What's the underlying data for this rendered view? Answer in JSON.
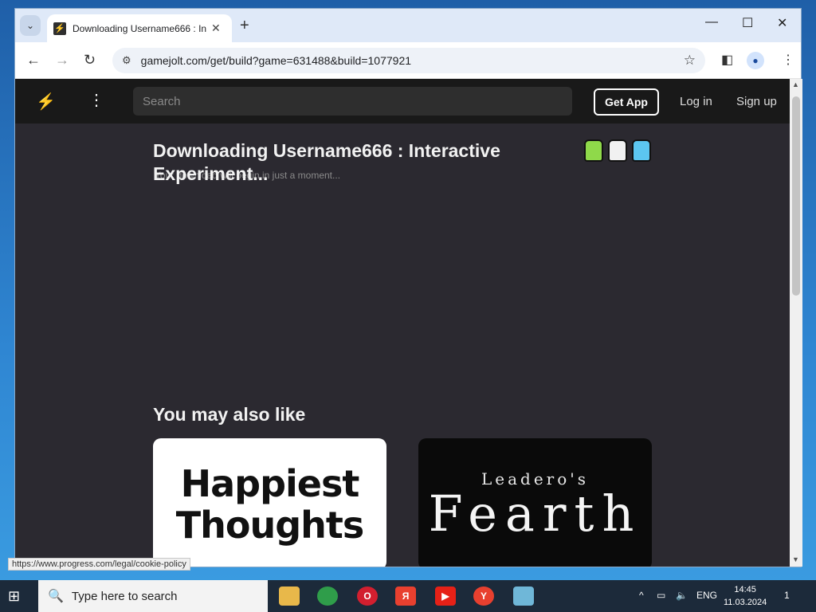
{
  "browser": {
    "tab_title": "Downloading Username666 : In",
    "url": "gamejolt.com/get/build?game=631488&build=1077921",
    "status_url": "https://www.progress.com/legal/cookie-policy"
  },
  "gj_nav": {
    "search_placeholder": "Search",
    "get_app": "Get App",
    "login": "Log in",
    "signup": "Sign up"
  },
  "main": {
    "title": "Downloading Username666 : Interactive Experiment...",
    "subtitle": "Your download will begin in just a moment...",
    "ymal_heading": "You may also like",
    "cards": [
      {
        "line1": "Happiest",
        "line2": "Thoughts"
      },
      {
        "small": "Leadero's",
        "big": "Fearth"
      }
    ],
    "mascot_colors": [
      "#8fd94a",
      "#f1f1f1",
      "#5cc6f0"
    ]
  },
  "taskbar": {
    "search_placeholder": "Type here to search",
    "lang": "ENG",
    "time": "14:45",
    "date": "11.03.2024",
    "notification_count": "1"
  },
  "icons": [
    "tab-search-icon",
    "close-icon",
    "new-tab-icon",
    "minimize-icon",
    "maximize-icon",
    "window-close-icon",
    "back-icon",
    "forward-icon",
    "reload-icon",
    "site-info-icon",
    "star-icon",
    "sidepanel-icon",
    "profile-icon",
    "menu-icon",
    "gamejolt-logo-icon",
    "more-icon",
    "windows-start-icon",
    "search-icon"
  ]
}
